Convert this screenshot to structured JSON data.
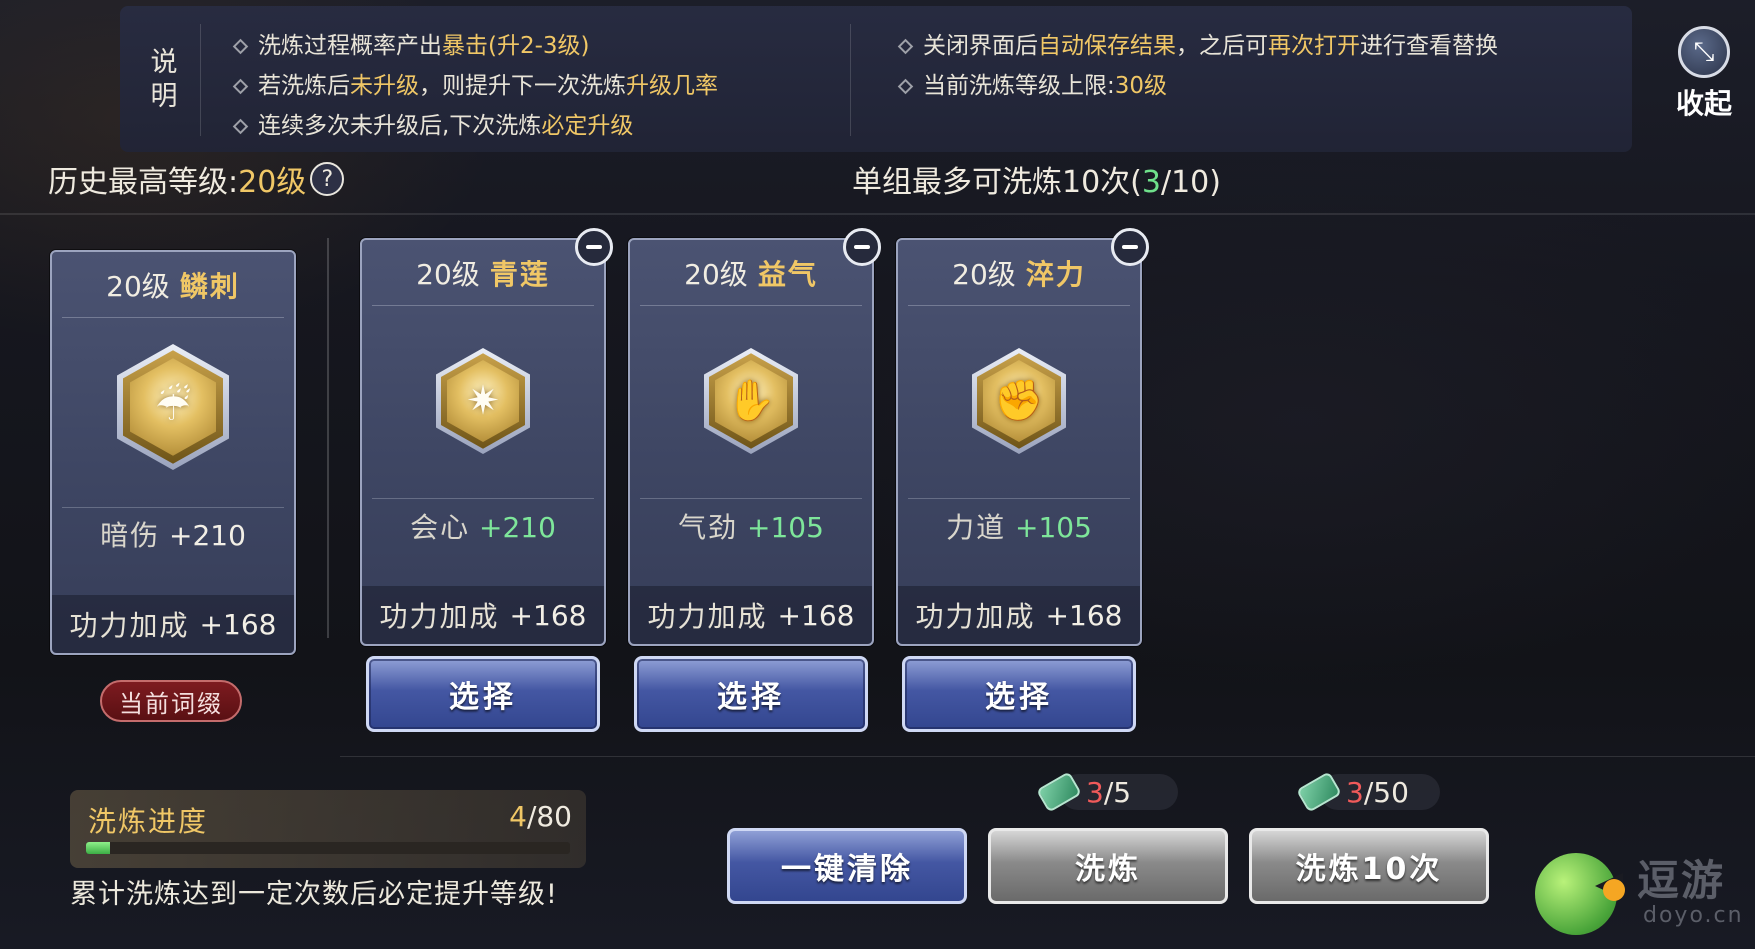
{
  "info": {
    "heading": "说明",
    "left_lines": [
      {
        "parts": [
          {
            "t": "洗炼过程概率产出",
            "h": false
          },
          {
            "t": "暴击(升2-3级)",
            "h": true
          }
        ]
      },
      {
        "parts": [
          {
            "t": "若洗炼后",
            "h": false
          },
          {
            "t": "未升级",
            "h": true
          },
          {
            "t": "，则提升下一次洗炼",
            "h": false
          },
          {
            "t": "升级几率",
            "h": true
          }
        ]
      },
      {
        "parts": [
          {
            "t": "连续多次未升级后,下次洗炼",
            "h": false
          },
          {
            "t": "必定升级",
            "h": true
          }
        ]
      }
    ],
    "right_lines": [
      {
        "parts": [
          {
            "t": "关闭界面后",
            "h": false
          },
          {
            "t": "自动保存结果",
            "h": true
          },
          {
            "t": "，之后可",
            "h": false
          },
          {
            "t": "再次打开",
            "h": true
          },
          {
            "t": "进行查看替换",
            "h": false
          }
        ]
      },
      {
        "parts": [
          {
            "t": "当前洗炼等级上限:",
            "h": false
          },
          {
            "t": "30级",
            "h": true
          }
        ]
      }
    ]
  },
  "collapse": {
    "label": "收起",
    "icon": "collapse-arrows-icon"
  },
  "header": {
    "history_label": "历史最高等级:",
    "history_value": "20级",
    "help_glyph": "?",
    "limit_label": "单组最多可洗炼10次(",
    "limit_current": "3",
    "limit_total": "/10)"
  },
  "current_card": {
    "level": "20级",
    "name": "鳞刺",
    "icon": "droplets-icon",
    "stat_name": "暗伤",
    "stat_value": "+210",
    "bonus_label": "功力加成",
    "bonus_value": "+168",
    "badge": "当前词缀"
  },
  "options": [
    {
      "level": "20级",
      "name": "青莲",
      "icon": "starburst-icon",
      "stat_name": "会心",
      "stat_value": "+210",
      "bonus_label": "功力加成",
      "bonus_value": "+168",
      "select_label": "选择"
    },
    {
      "level": "20级",
      "name": "益气",
      "icon": "palm-icon",
      "stat_name": "气劲",
      "stat_value": "+105",
      "bonus_label": "功力加成",
      "bonus_value": "+168",
      "select_label": "选择"
    },
    {
      "level": "20级",
      "name": "淬力",
      "icon": "fist-icon",
      "stat_name": "力道",
      "stat_value": "+105",
      "bonus_label": "功力加成",
      "bonus_value": "+168",
      "select_label": "选择"
    }
  ],
  "progress": {
    "label": "洗炼进度",
    "current": "4",
    "total": "/80",
    "fraction": 0.05,
    "hint": "累计洗炼达到一定次数后必定提升等级!"
  },
  "costs": [
    {
      "icon": "jade-token-icon",
      "have": "3",
      "need": "/5"
    },
    {
      "icon": "jade-token-icon",
      "have": "3",
      "need": "/50"
    }
  ],
  "actions": {
    "clear_label": "一键清除",
    "wash_label": "洗炼",
    "wash10_label": "洗炼10次"
  },
  "watermark": {
    "title": "逗游",
    "sub": "doyo.cn"
  }
}
